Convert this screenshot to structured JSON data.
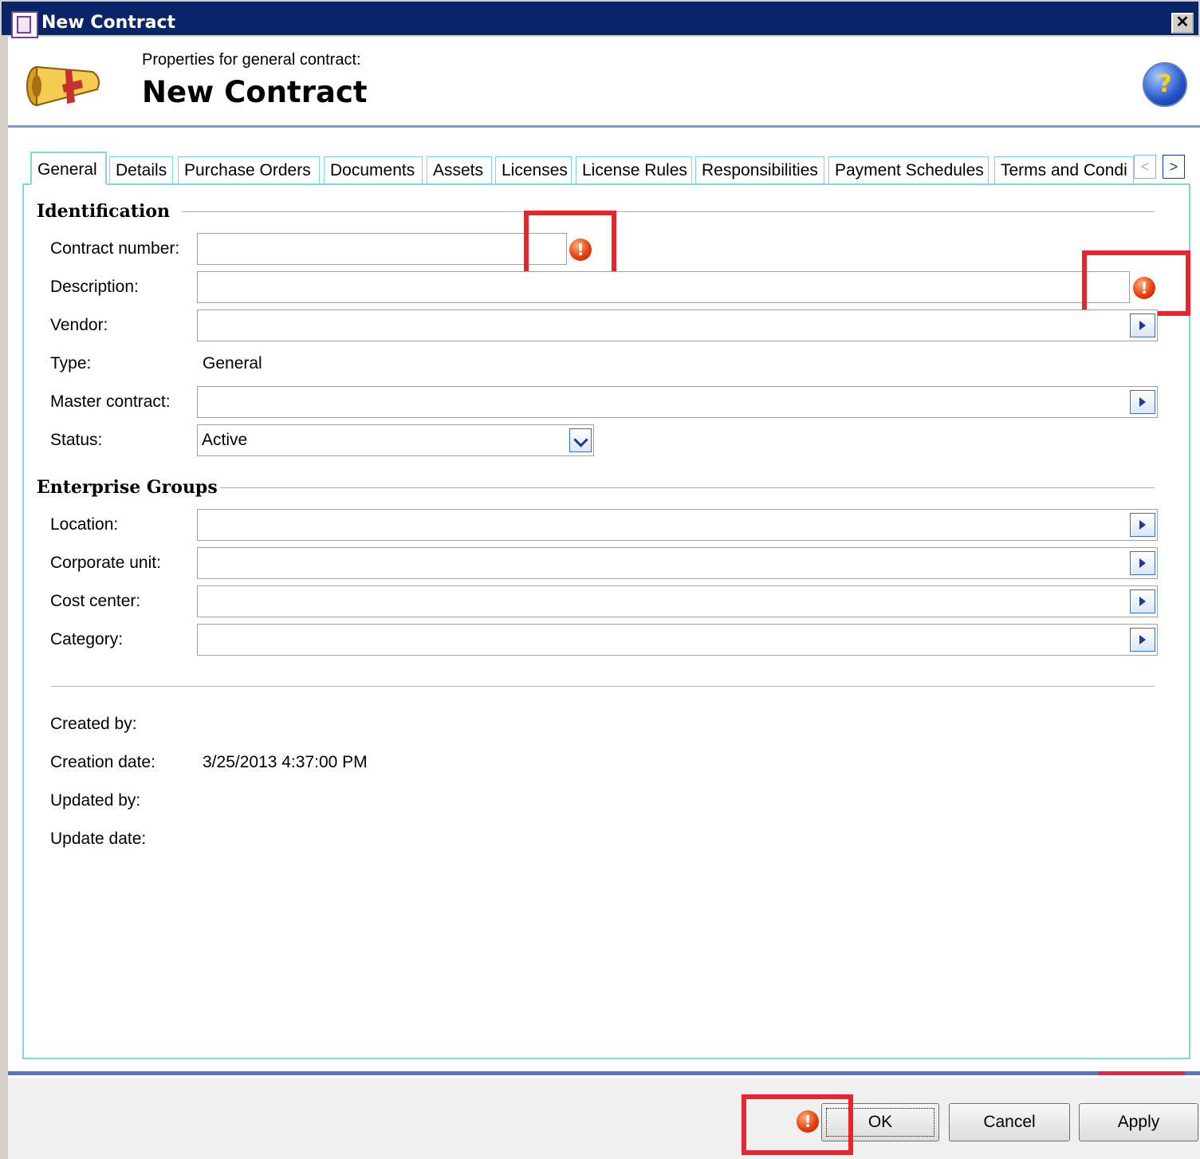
{
  "window": {
    "title": "New Contract",
    "close_label": "✕"
  },
  "header": {
    "subtitle": "Properties for general contract:",
    "title": "New Contract",
    "help_label": "?"
  },
  "tabs": [
    {
      "label": "General",
      "active": true
    },
    {
      "label": "Details"
    },
    {
      "label": "Purchase Orders"
    },
    {
      "label": "Documents"
    },
    {
      "label": "Assets"
    },
    {
      "label": "Licenses"
    },
    {
      "label": "License Rules"
    },
    {
      "label": "Responsibilities"
    },
    {
      "label": "Payment Schedules"
    },
    {
      "label": "Terms and Condi"
    }
  ],
  "tab_scroll": {
    "prev": "<",
    "next": ">"
  },
  "identification": {
    "title": "Identification",
    "contract_number_label": "Contract number:",
    "contract_number_value": "",
    "description_label": "Description:",
    "description_value": "",
    "vendor_label": "Vendor:",
    "vendor_value": "",
    "type_label": "Type:",
    "type_value": "General",
    "master_contract_label": "Master contract:",
    "master_contract_value": "",
    "status_label": "Status:",
    "status_value": "Active"
  },
  "enterprise_groups": {
    "title": "Enterprise Groups",
    "location_label": "Location:",
    "corporate_unit_label": "Corporate unit:",
    "cost_center_label": "Cost center:",
    "category_label": "Category:"
  },
  "audit": {
    "created_by_label": "Created by:",
    "created_by_value": "",
    "creation_date_label": "Creation date:",
    "creation_date_value": "3/25/2013 4:37:00 PM",
    "updated_by_label": "Updated by:",
    "updated_by_value": "",
    "update_date_label": "Update date:",
    "update_date_value": ""
  },
  "warning_glyph": "!",
  "buttons": {
    "ok": "OK",
    "cancel": "Cancel",
    "apply": "Apply"
  },
  "colors": {
    "title_bar": "#0a246a",
    "tab_border": "#7fd6e6",
    "warning": "#e84010",
    "highlight": "#e8242c",
    "accent_line": "#5a72c8"
  }
}
